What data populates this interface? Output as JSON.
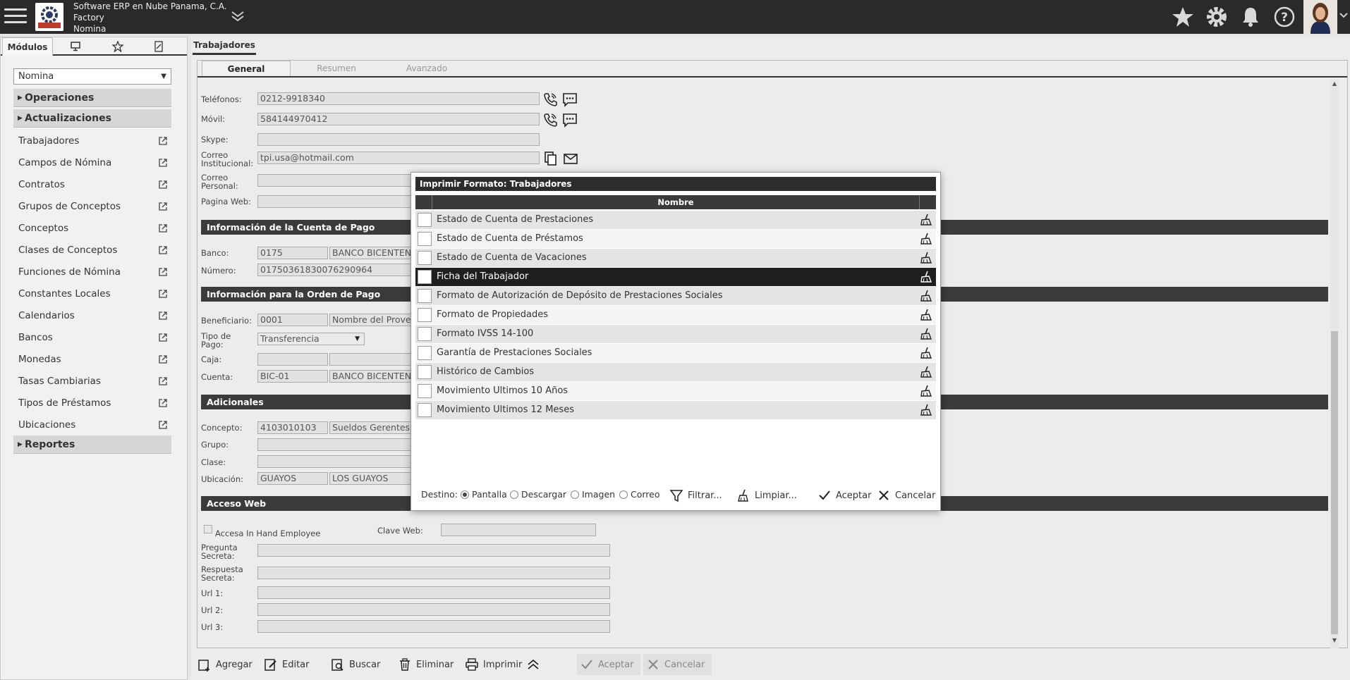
{
  "header": {
    "company": "Software ERP en Nube Panama, C.A.",
    "branch": "Factory",
    "module": "Nomina"
  },
  "left_panel": {
    "tabs": [
      "Módulos"
    ],
    "module_select": "Nomina",
    "groups": {
      "operaciones": "Operaciones",
      "actualizaciones": "Actualizaciones",
      "reportes": "Reportes"
    },
    "items": [
      "Trabajadores",
      "Campos de Nómina",
      "Contratos",
      "Grupos de Conceptos",
      "Conceptos",
      "Clases de Conceptos",
      "Funciones de Nómina",
      "Constantes Locales",
      "Calendarios",
      "Bancos",
      "Monedas",
      "Tasas Cambiarias",
      "Tipos de Préstamos",
      "Ubicaciones"
    ]
  },
  "main": {
    "tab": "Trabajadores",
    "form_tabs": [
      "General",
      "Resumen",
      "Avanzado"
    ],
    "fields": {
      "telefonos": {
        "label": "Teléfonos:",
        "value": "0212-9918340"
      },
      "movil": {
        "label": "Móvil:",
        "value": "584144970412"
      },
      "skype": {
        "label": "Skype:",
        "value": ""
      },
      "correo_inst": {
        "label1": "Correo",
        "label2": "Institucional:",
        "value": "tpi.usa@hotmail.com"
      },
      "correo_pers": {
        "label1": "Correo",
        "label2": "Personal:",
        "value": ""
      },
      "pagina_web": {
        "label": "Pagina Web:",
        "value": ""
      }
    },
    "sections": {
      "cuenta_pago": "Información de la Cuenta de Pago",
      "orden_pago": "Información para la Orden de Pago",
      "adicionales": "Adicionales",
      "acceso_web": "Acceso Web"
    },
    "cuenta_pago": {
      "banco_label": "Banco:",
      "banco_code": "0175",
      "banco_name": "BANCO BICENTENA",
      "numero_label": "Número:",
      "numero": "01750361830076290964"
    },
    "orden_pago": {
      "beneficiario_label": "Beneficiario:",
      "beneficiario_code": "0001",
      "beneficiario_name": "Nombre del Provee",
      "tipo_pago_label1": "Tipo de",
      "tipo_pago_label2": "Pago:",
      "tipo_pago": "Transferencia",
      "caja_label": "Caja:",
      "cuenta_label": "Cuenta:",
      "cuenta_code": "BIC-01",
      "cuenta_name": "BANCO BICENTENA"
    },
    "adicionales": {
      "concepto_label": "Concepto:",
      "concepto_code": "4103010103",
      "concepto_name": "Sueldos Gerentes",
      "grupo_label": "Grupo:",
      "clase_label": "Clase:",
      "ubicacion_label": "Ubicación:",
      "ubicacion_code": "GUAYOS",
      "ubicacion_name": "LOS GUAYOS"
    },
    "acceso_web": {
      "accesa_label": "Accesa In Hand Employee",
      "clave_label": "Clave Web:",
      "pregunta_label1": "Pregunta",
      "pregunta_label2": "Secreta:",
      "respuesta_label1": "Respuesta",
      "respuesta_label2": "Secreta:",
      "url1_label": "Url 1:",
      "url2_label": "Url 2:",
      "url3_label": "Url 3:"
    }
  },
  "toolbar": {
    "agregar": "Agregar",
    "editar": "Editar",
    "buscar": "Buscar",
    "eliminar": "Eliminar",
    "imprimir": "Imprimir",
    "aceptar": "Aceptar",
    "cancelar": "Cancelar"
  },
  "modal": {
    "title": "Imprimir Formato: Trabajadores",
    "column": "Nombre",
    "rows": [
      "Estado de Cuenta de Prestaciones",
      "Estado de Cuenta de Préstamos",
      "Estado de Cuenta de Vacaciones",
      "Ficha del Trabajador",
      "Formato de Autorización de Depósito de Prestaciones Sociales",
      "Formato de Propiedades",
      "Formato IVSS 14-100",
      "Garantía de Prestaciones Sociales",
      "Histórico de Cambios",
      "Movimiento Ultimos 10 Años",
      "Movimiento Ultimos 12 Meses"
    ],
    "selected_row": "Ficha del Trabajador",
    "destino_label": "Destino:",
    "destinos": [
      "Pantalla",
      "Descargar",
      "Imagen",
      "Correo"
    ],
    "destino_selected": "Pantalla",
    "filtrar": "Filtrar...",
    "limpiar": "Limpiar...",
    "aceptar": "Aceptar",
    "cancelar": "Cancelar"
  }
}
